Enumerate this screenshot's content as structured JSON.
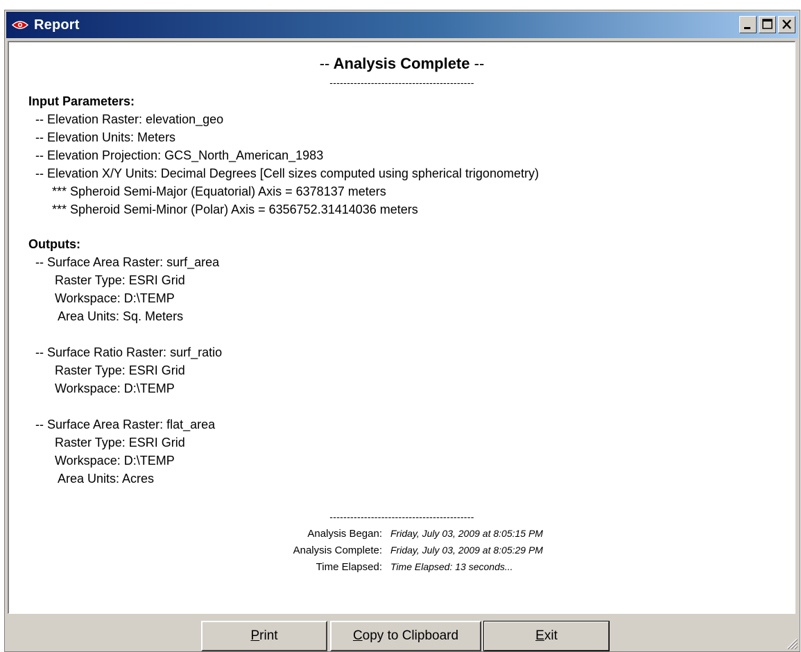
{
  "window": {
    "title": "Report",
    "controls": {
      "minimize": "minimize",
      "maximize": "maximize",
      "close": "close"
    }
  },
  "report": {
    "heading": "Analysis Complete",
    "heading_prefix": "--",
    "heading_suffix": "--",
    "separator": "------------------------------------------",
    "input_parameters": {
      "title": "Input Parameters:",
      "lines": [
        "-- Elevation Raster:  elevation_geo",
        "-- Elevation Units:  Meters",
        "-- Elevation Projection:  GCS_North_American_1983",
        "-- Elevation X/Y Units:  Decimal Degrees [Cell sizes computed using spherical trigonometry)"
      ],
      "sub_lines": [
        "*** Spheroid Semi-Major (Equatorial) Axis = 6378137 meters",
        "*** Spheroid Semi-Minor (Polar) Axis = 6356752.31414036 meters"
      ]
    },
    "outputs": {
      "title": "Outputs:",
      "groups": [
        {
          "header": "-- Surface Area Raster:  surf_area",
          "details": [
            "Raster Type:  ESRI Grid",
            "Workspace:  D:\\TEMP",
            "Area Units:  Sq. Meters"
          ]
        },
        {
          "header": "-- Surface Ratio Raster:  surf_ratio",
          "details": [
            "Raster Type:  ESRI Grid",
            "Workspace:  D:\\TEMP"
          ]
        },
        {
          "header": "-- Surface Area Raster:  flat_area",
          "details": [
            "Raster Type:  ESRI Grid",
            "Workspace:  D:\\TEMP",
            "Area Units:  Acres"
          ]
        }
      ]
    },
    "footer": {
      "separator": "------------------------------------------",
      "began_label": "Analysis Began:",
      "began_value": "Friday, July 03, 2009 at 8:05:15 PM",
      "complete_label": "Analysis Complete:",
      "complete_value": "Friday, July 03, 2009 at 8:05:29 PM",
      "elapsed_label": "Time Elapsed:",
      "elapsed_value": "Time Elapsed: 13 seconds..."
    }
  },
  "buttons": {
    "print": {
      "mnemonic": "P",
      "rest": "rint"
    },
    "copy": {
      "mnemonic": "C",
      "rest": "opy to Clipboard"
    },
    "exit": {
      "mnemonic": "E",
      "rest": "xit"
    }
  },
  "colors": {
    "titlebar_start": "#0a246a",
    "titlebar_end": "#a6caf0",
    "window_face": "#d4d0c8",
    "icon_red": "#e00000"
  },
  "icons": {
    "app": "eye-icon",
    "minimize": "minimize-icon",
    "maximize": "maximize-icon",
    "close": "close-icon",
    "resize": "resize-grip-icon"
  }
}
